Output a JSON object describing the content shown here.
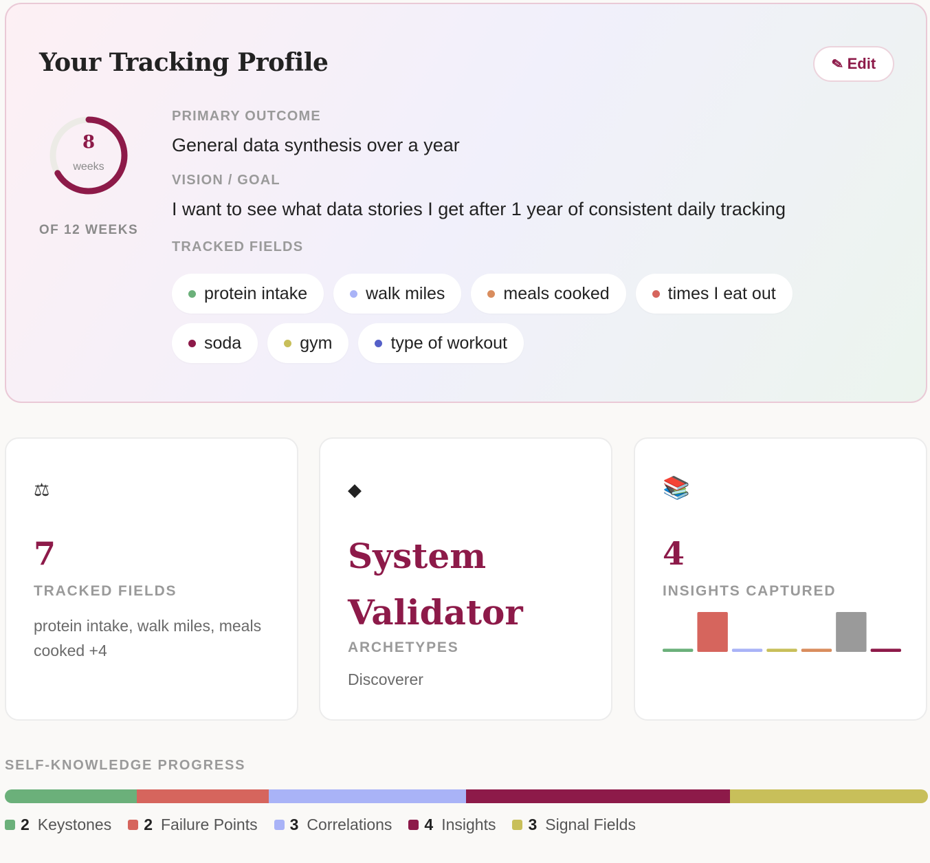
{
  "profile": {
    "title": "Your Tracking Profile",
    "edit_label": "Edit",
    "weeks_done": 8,
    "weeks_done_text": "8",
    "weeks_unit": "weeks",
    "weeks_total": 12,
    "weeks_caption": "OF 12 WEEKS",
    "primary_outcome_label": "PRIMARY OUTCOME",
    "primary_outcome": "General data synthesis over a year",
    "vision_label": "VISION / GOAL",
    "vision": "I want to see what data stories I get after 1 year of consistent daily tracking",
    "tracked_fields_label": "TRACKED FIELDS",
    "fields": [
      {
        "name": "protein intake",
        "color": "#6bb07a"
      },
      {
        "name": "walk miles",
        "color": "#a9b3f7"
      },
      {
        "name": "meals cooked",
        "color": "#d98d5e"
      },
      {
        "name": "times I eat out",
        "color": "#d6655d"
      },
      {
        "name": "soda",
        "color": "#8d1a49"
      },
      {
        "name": "gym",
        "color": "#c8bf5a"
      },
      {
        "name": "type of workout",
        "color": "#5560c8"
      }
    ]
  },
  "stats": {
    "fields_card": {
      "icon": "balance-scale-icon",
      "icon_glyph": "⚖",
      "number": "7",
      "label": "TRACKED FIELDS",
      "desc": "protein intake, walk miles, meals cooked +4"
    },
    "archetype_card": {
      "icon": "diamond-icon",
      "icon_glyph": "◆",
      "title": "System Validator",
      "label": "ARCHETYPES",
      "desc": "Discoverer"
    },
    "insights_card": {
      "icon": "books-icon",
      "icon_glyph": "📚",
      "number": "4",
      "label": "INSIGHTS CAPTURED",
      "bars": [
        {
          "level": 0.08,
          "color": "#6bb07a"
        },
        {
          "level": 1.0,
          "color": "#d6655d"
        },
        {
          "level": 0.08,
          "color": "#a9b3f7"
        },
        {
          "level": 0.08,
          "color": "#c8bf5a"
        },
        {
          "level": 0.08,
          "color": "#d98d5e"
        },
        {
          "level": 1.0,
          "color": "#9a9a9a"
        },
        {
          "level": 0.08,
          "color": "#8d1a49"
        }
      ]
    }
  },
  "progress": {
    "title": "SELF-KNOWLEDGE PROGRESS",
    "segments": [
      {
        "count": 2,
        "count_text": "2",
        "label": "Keystones",
        "color": "#6bb07a"
      },
      {
        "count": 2,
        "count_text": "2",
        "label": "Failure Points",
        "color": "#d6655d"
      },
      {
        "count": 3,
        "count_text": "3",
        "label": "Correlations",
        "color": "#a9b3f7"
      },
      {
        "count": 4,
        "count_text": "4",
        "label": "Insights",
        "color": "#8d1a49"
      },
      {
        "count": 3,
        "count_text": "3",
        "label": "Signal Fields",
        "color": "#c8bf5a"
      }
    ]
  }
}
